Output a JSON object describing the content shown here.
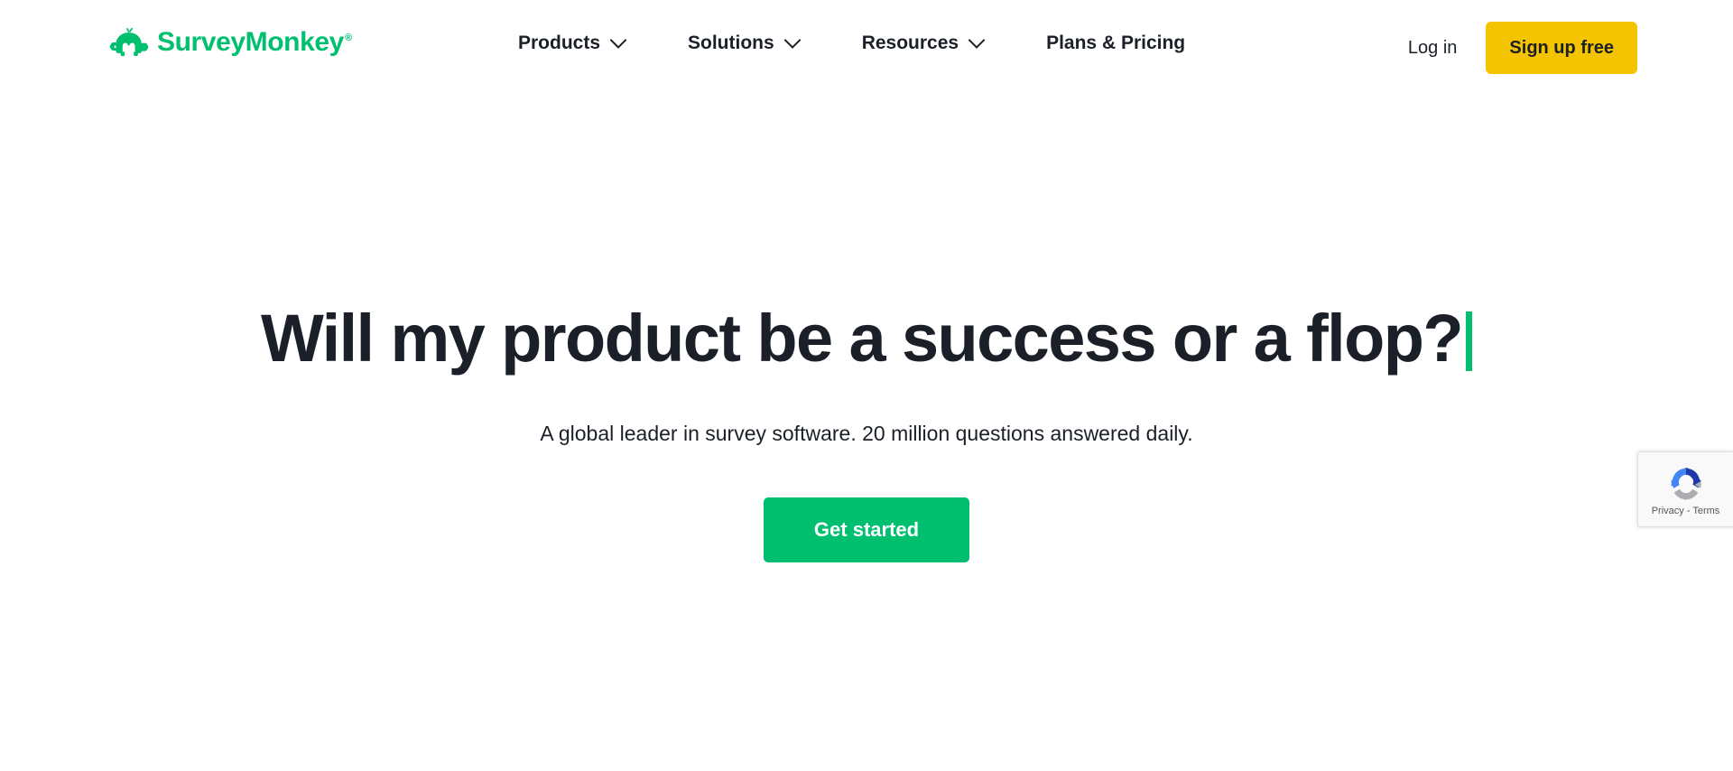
{
  "header": {
    "logo": {
      "icon": "surveymonkey-monkey-icon",
      "word": "SurveyMonkey",
      "trademark": "®",
      "color": "#00bf6f"
    },
    "nav": [
      {
        "label": "Products",
        "has_dropdown": true,
        "icon": "chevron-down-icon"
      },
      {
        "label": "Solutions",
        "has_dropdown": true,
        "icon": "chevron-down-icon"
      },
      {
        "label": "Resources",
        "has_dropdown": true,
        "icon": "chevron-down-icon"
      },
      {
        "label": "Plans & Pricing",
        "has_dropdown": false,
        "icon": ""
      }
    ],
    "login_label": "Log in",
    "signup_label": "Sign up free",
    "signup_color": "#f5c400"
  },
  "hero": {
    "headline": "Will my product be a success or a flop?",
    "caret_color": "#00bf6f",
    "subheadline": "A global leader in survey software. 20 million questions answered daily.",
    "cta_label": "Get started",
    "cta_color": "#00bf6f"
  },
  "recaptcha": {
    "icon": "recaptcha-logo-icon",
    "privacy_label": "Privacy",
    "separator": "-",
    "terms_label": "Terms"
  },
  "colors": {
    "brand_green": "#00bf6f",
    "accent_yellow": "#f5c400",
    "text_dark": "#1b2028",
    "page_background": "#ffffff"
  }
}
